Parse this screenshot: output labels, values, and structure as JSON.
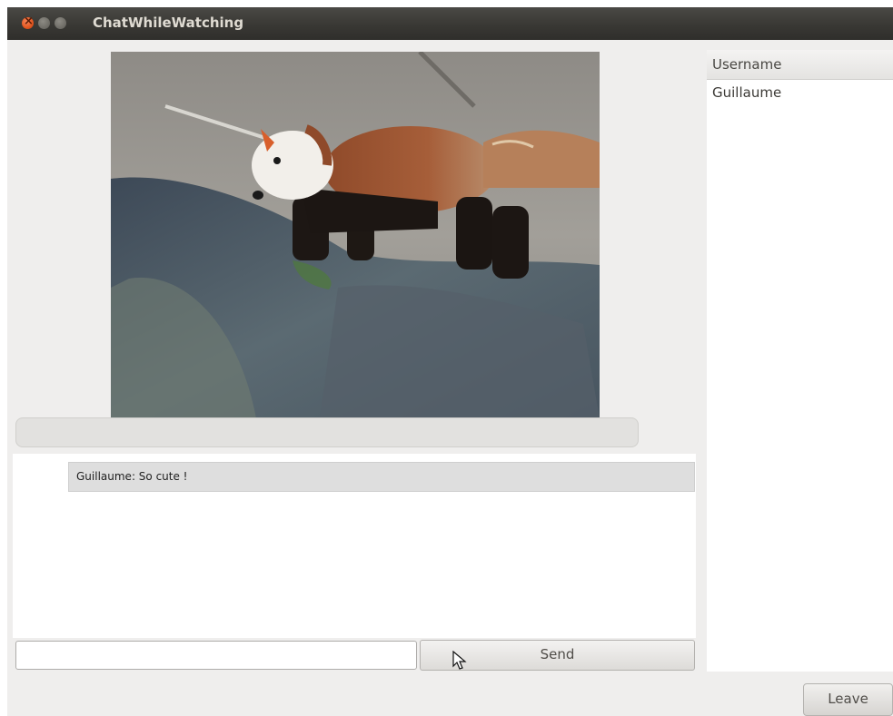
{
  "window": {
    "title": "ChatWhileWatching"
  },
  "chat": {
    "messages": [
      {
        "text": "Guillaume: So cute !"
      }
    ],
    "input_value": ""
  },
  "buttons": {
    "send_label": "Send",
    "leave_label": "Leave"
  },
  "users": {
    "header": "Username",
    "list": [
      "Guillaume"
    ]
  },
  "video": {
    "subject": "red panda walking on rocks",
    "progress": 0
  }
}
